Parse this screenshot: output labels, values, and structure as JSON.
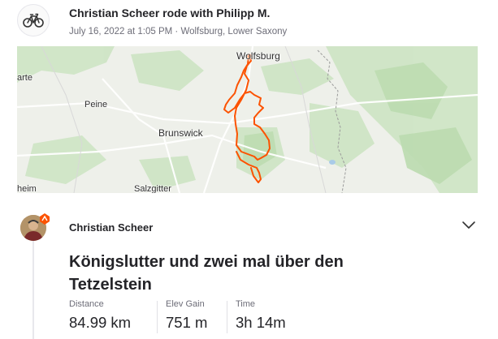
{
  "group": {
    "title": "Christian Scheer rode with Philipp M.",
    "meta": "July 16, 2022 at 1:05 PM · Wolfsburg, Lower Saxony",
    "icon": "bike-icon"
  },
  "map": {
    "labels": {
      "wolfsburg": "Wolfsburg",
      "peine": "Peine",
      "brunswick": "Brunswick",
      "salzgitter": "Salzgitter",
      "harte": "arte",
      "heim": "heim"
    },
    "route_color": "#fc5200"
  },
  "athlete": {
    "name": "Christian Scheer",
    "badge_color": "#fc5200"
  },
  "activity": {
    "title": "Königslutter und zwei mal über den Tetzelstein",
    "stats": [
      {
        "label": "Distance",
        "value": "84.99 km"
      },
      {
        "label": "Elev Gain",
        "value": "751 m"
      },
      {
        "label": "Time",
        "value": "3h 14m"
      }
    ]
  }
}
